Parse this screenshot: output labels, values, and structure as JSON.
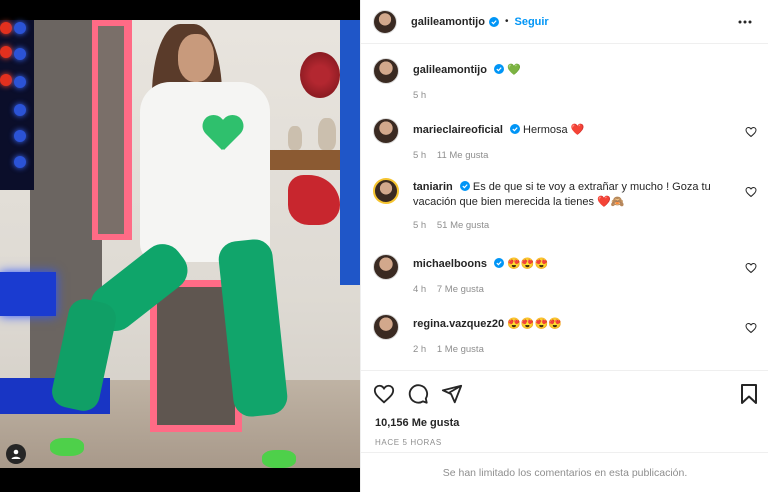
{
  "post": {
    "author": "galileamontijo",
    "follow_label": "Seguir",
    "separator": "•",
    "caption_author": "galileamontijo",
    "caption_emoji": "💚",
    "caption_time": "5 h",
    "likes": "10,156 Me gusta",
    "posted_ago": "HACE 5 HORAS",
    "comments_limited": "Se han limitado los comentarios en esta publicación."
  },
  "comments": [
    {
      "user": "marieclaireoficial",
      "text": "Hermosa",
      "emoji": "❤️",
      "time": "5 h",
      "likes": "11 Me gusta",
      "verified": true
    },
    {
      "user": "taniarin",
      "text": "Es de que si te voy a extrañar y mucho ! Goza tu vacación que bien merecida la tienes",
      "emoji": "❤️🙈",
      "time": "5 h",
      "likes": "51 Me gusta",
      "verified": true
    },
    {
      "user": "michaelboons",
      "text": "",
      "emoji": "😍😍😍",
      "time": "4 h",
      "likes": "7 Me gusta",
      "verified": true
    },
    {
      "user": "regina.vazquez20",
      "text": "",
      "emoji": "😍😍😍😍",
      "time": "2 h",
      "likes": "1 Me gusta",
      "verified": false
    }
  ],
  "colors": {
    "accent": "#0095f6",
    "muted": "#8e8e8e",
    "text": "#262626",
    "verified": "#0095f6"
  },
  "icons": [
    "heart-icon",
    "comment-icon",
    "share-icon",
    "bookmark-icon",
    "more-icon",
    "verified-icon",
    "user-tag-icon"
  ]
}
